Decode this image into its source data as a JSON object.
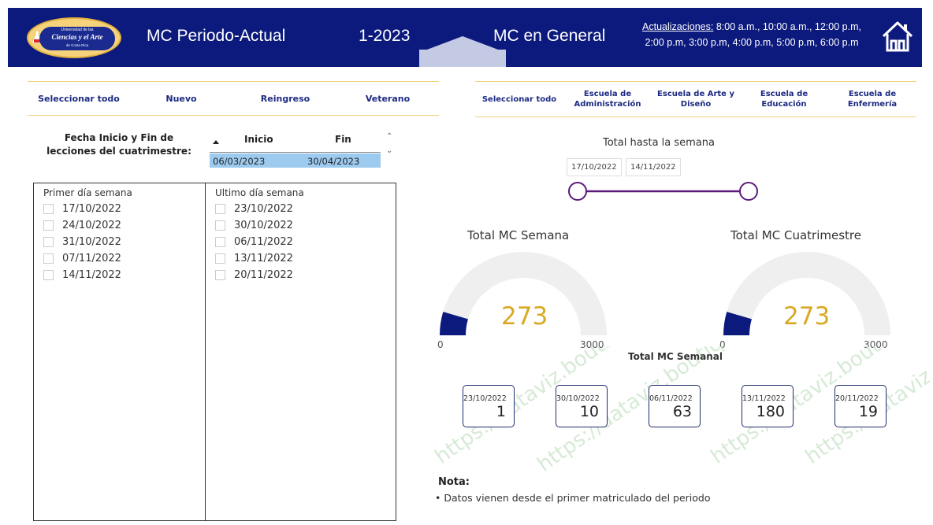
{
  "header": {
    "logo": {
      "small": "Universidad de las",
      "main": "Ciencias y el Arte",
      "sub": "de Costa Rica"
    },
    "title": "MC Periodo-Actual",
    "period": "1-2023",
    "general": "MC en General",
    "updates_label": "Actualizaciones:",
    "updates_line1": " 8:00 a.m., 10:00 a.m., 12:00 p.m,",
    "updates_line2": "2:00 p.m, 3:00 p.m, 4:00 p.m, 5:00 p.m, 6:00 p.m",
    "home_icon": "home-icon"
  },
  "student_slicer": [
    "Seleccionar todo",
    "Nuevo",
    "Reingreso",
    "Veterano"
  ],
  "school_slicer": [
    "Seleccionar todo",
    "Escuela de Administración",
    "Escuela de Arte y Diseño",
    "Escuela de Educación",
    "Escuela de Enfermería"
  ],
  "date_table": {
    "label": "Fecha Inicio y Fin de lecciones del cuatrimestre:",
    "col_inicio": "Inicio",
    "col_fin": "Fin",
    "inicio": "06/03/2023",
    "fin": "30/04/2023",
    "highlight": "#9dcbf0"
  },
  "weeks": {
    "first_title": "Primer día semana",
    "first": [
      "17/10/2022",
      "24/10/2022",
      "31/10/2022",
      "07/11/2022",
      "14/11/2022"
    ],
    "last_title": "Ultimo día semana",
    "last": [
      "23/10/2022",
      "30/10/2022",
      "06/11/2022",
      "13/11/2022",
      "20/11/2022"
    ]
  },
  "range": {
    "title": "Total hasta la semana",
    "start": "17/10/2022",
    "end": "14/11/2022",
    "color": "#5a1a7a"
  },
  "gauges": [
    {
      "title": "Total MC Semana",
      "value": "273",
      "min": "0",
      "max": "3000",
      "fraction": 0.091
    },
    {
      "title": "Total MC Cuatrimestre",
      "value": "273",
      "min": "0",
      "max": "3000",
      "fraction": 0.091
    }
  ],
  "gauge_colors": {
    "fill": "#0c1a7d",
    "track": "#efefef",
    "value": "#d9a924"
  },
  "semanal": {
    "title": "Total MC Semanal",
    "cards": [
      {
        "date": "23/10/2022",
        "value": "1"
      },
      {
        "date": "30/10/2022",
        "value": "10"
      },
      {
        "date": "06/11/2022",
        "value": "63"
      },
      {
        "date": "13/11/2022",
        "value": "180"
      },
      {
        "date": "20/11/2022",
        "value": "19"
      }
    ]
  },
  "watermark": "https://dataviz.boutique",
  "nota": {
    "label": "Nota:",
    "text": "• Datos vienen desde el primer matriculado del periodo"
  },
  "colors": {
    "header_bg": "#0c1a7d",
    "slicer_border": "#f0d27a",
    "slicer_text": "#1c2a82"
  }
}
